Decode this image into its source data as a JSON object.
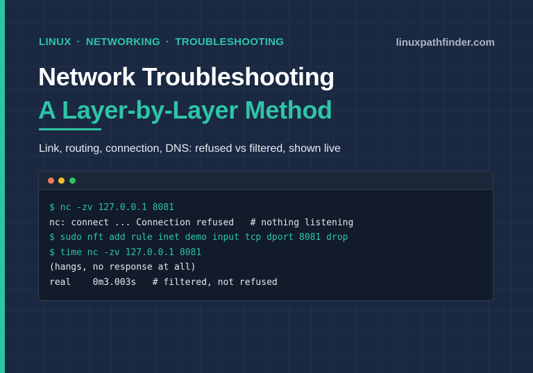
{
  "header": {
    "tags": [
      "LINUX",
      "NETWORKING",
      "TROUBLESHOOTING"
    ],
    "separator": "·",
    "site": "linuxpathfinder.com"
  },
  "hero": {
    "title_line1": "Network Troubleshooting",
    "title_line2": "A Layer-by-Layer Method",
    "subtitle": "Link, routing, connection, DNS: refused vs filtered, shown live"
  },
  "colors": {
    "accent": "#2ec4a5",
    "background": "#1a2842",
    "terminal_bg": "#111b2a"
  },
  "terminal": {
    "window_buttons": [
      "close",
      "minimize",
      "maximize"
    ],
    "lines": [
      {
        "kind": "cmd",
        "text": "$ nc -zv 127.0.0.1 8081"
      },
      {
        "kind": "out",
        "text": "nc: connect ... Connection refused   # nothing listening"
      },
      {
        "kind": "cmd",
        "text": "$ sudo nft add rule inet demo input tcp dport 8081 drop"
      },
      {
        "kind": "cmd",
        "text": "$ time nc -zv 127.0.0.1 8081"
      },
      {
        "kind": "out",
        "text": "(hangs, no response at all)"
      },
      {
        "kind": "out",
        "text": "real    0m3.003s   # filtered, not refused"
      }
    ]
  }
}
